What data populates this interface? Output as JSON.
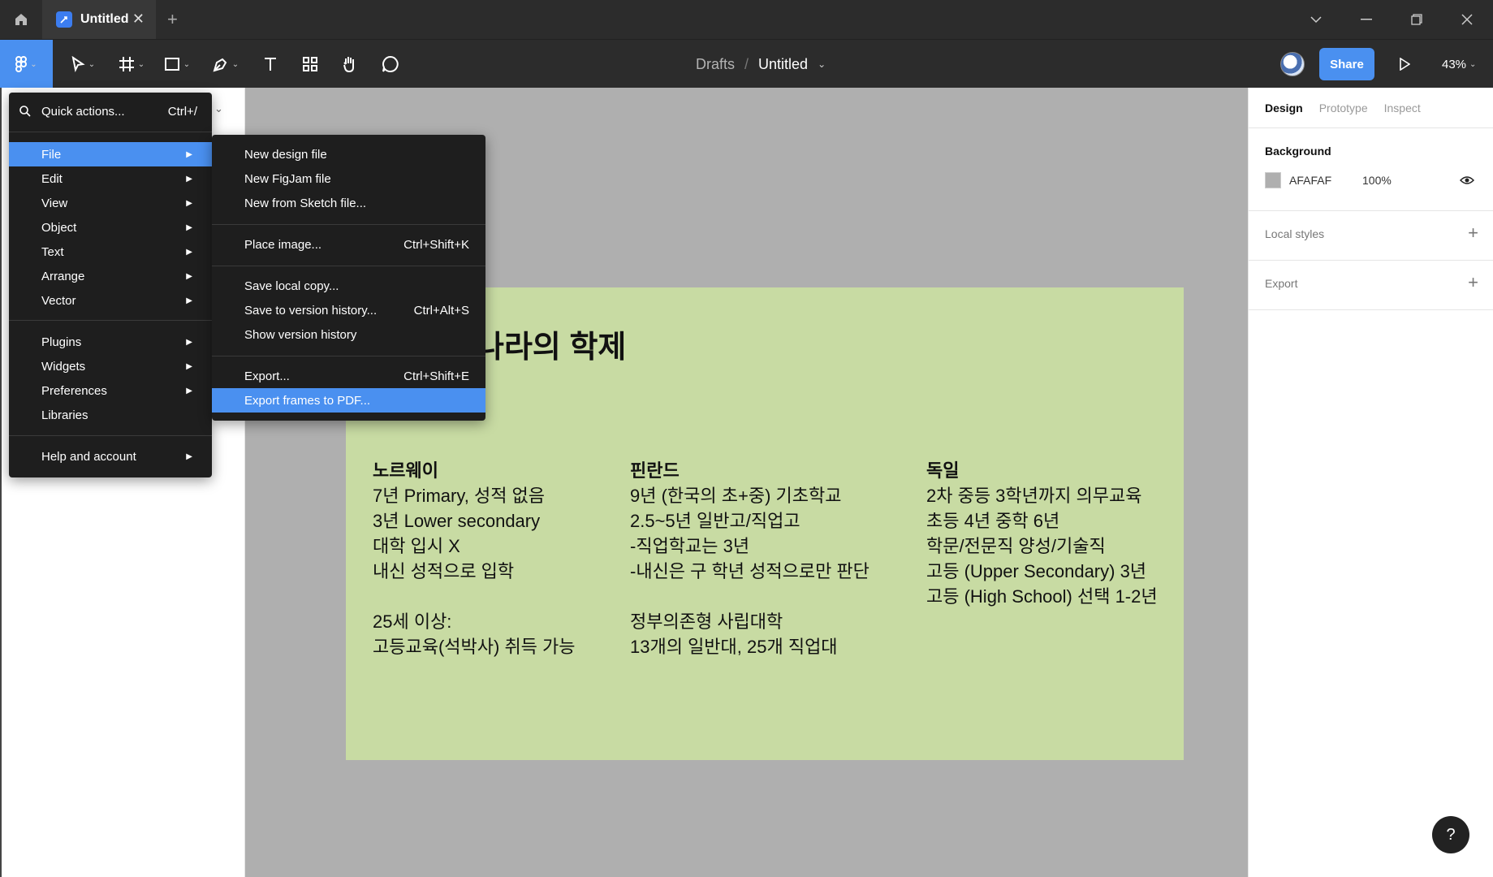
{
  "titlebar": {
    "tab_title": "Untitled",
    "tab_close": "✕",
    "new_tab": "+"
  },
  "toolbar": {
    "breadcrumb_drafts": "Drafts",
    "breadcrumb_sep": "/",
    "breadcrumb_file": "Untitled",
    "share_label": "Share",
    "zoom_label": "43%"
  },
  "main_menu": {
    "quick_actions": {
      "label": "Quick actions...",
      "shortcut": "Ctrl+/"
    },
    "items": [
      {
        "label": "File"
      },
      {
        "label": "Edit"
      },
      {
        "label": "View"
      },
      {
        "label": "Object"
      },
      {
        "label": "Text"
      },
      {
        "label": "Arrange"
      },
      {
        "label": "Vector"
      },
      {
        "label": "Plugins"
      },
      {
        "label": "Widgets"
      },
      {
        "label": "Preferences"
      },
      {
        "label": "Libraries"
      },
      {
        "label": "Help and account"
      }
    ]
  },
  "file_submenu": {
    "items": [
      {
        "label": "New design file",
        "shortcut": ""
      },
      {
        "label": "New FigJam file",
        "shortcut": ""
      },
      {
        "label": "New from Sketch file...",
        "shortcut": ""
      },
      {
        "label": "Place image...",
        "shortcut": "Ctrl+Shift+K"
      },
      {
        "label": "Save local copy...",
        "shortcut": ""
      },
      {
        "label": "Save to version history...",
        "shortcut": "Ctrl+Alt+S"
      },
      {
        "label": "Show version history",
        "shortcut": ""
      },
      {
        "label": "Export...",
        "shortcut": "Ctrl+Shift+E"
      },
      {
        "label": "Export frames to PDF...",
        "shortcut": ""
      }
    ]
  },
  "canvas": {
    "frame_title": "나라의 학제",
    "columns": [
      {
        "head": "노르웨이",
        "lines": [
          "7년 Primary, 성적 없음",
          "3년 Lower secondary",
          "대학 입시 X",
          "내신 성적으로 입학",
          "",
          "25세 이상:",
          "고등교육(석박사) 취득 가능"
        ]
      },
      {
        "head": "핀란드",
        "lines": [
          "9년 (한국의 초+중) 기초학교",
          "2.5~5년 일반고/직업고",
          "-직업학교는 3년",
          "-내신은 구 학년 성적으로만 판단",
          "",
          "정부의존형 사립대학",
          "13개의 일반대, 25개 직업대"
        ]
      },
      {
        "head": "독일",
        "lines": [
          "2차 중등 3학년까지 의무교육",
          "초등 4년 중학 6년",
          "학문/전문직 양성/기술직",
          "고등 (Upper Secondary) 3년",
          "고등 (High School) 선택 1-2년"
        ]
      }
    ]
  },
  "right_panel": {
    "tabs": [
      "Design",
      "Prototype",
      "Inspect"
    ],
    "background_title": "Background",
    "background_hex": "AFAFAF",
    "background_opacity": "100%",
    "local_styles_title": "Local styles",
    "export_title": "Export",
    "help": "?"
  },
  "colors": {
    "accent": "#4a90f0",
    "canvas_bg": "#afafaf",
    "frame_bg": "#c8dba3"
  }
}
